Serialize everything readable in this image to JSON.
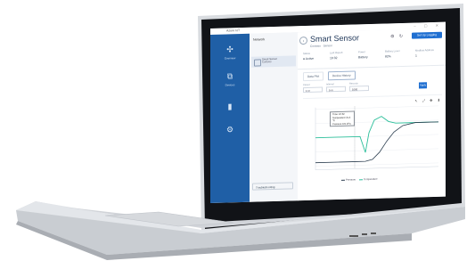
{
  "app": {
    "name": "Azure IoT",
    "window_controls": "– ▢ ✕"
  },
  "rail": {
    "items": [
      {
        "icon": "network-icon",
        "glyph": "✣",
        "label": "Overview"
      },
      {
        "icon": "folder-icon",
        "glyph": "🗀",
        "label": "Devices"
      },
      {
        "icon": "sensor-icon",
        "glyph": "⬮",
        "label": ""
      },
      {
        "icon": "settings-icon",
        "glyph": "⚙",
        "label": ""
      }
    ]
  },
  "devices": {
    "header": "Network",
    "items": [
      {
        "label": "Smart Sensor",
        "sub": "Contoso"
      }
    ],
    "troubleshoot_label": "Troubleshooting"
  },
  "main": {
    "title": "Smart Sensor",
    "subtitle": "Contoso · Sensor",
    "setup_button": "Set Up Logging",
    "stats": [
      {
        "key": "Status",
        "value": "● Active"
      },
      {
        "key": "Last Report",
        "value": "10:32"
      },
      {
        "key": "Power",
        "value": "Battery"
      },
      {
        "key": "Battery Level",
        "value": "82%"
      },
      {
        "key": "Modbus Address",
        "value": "1"
      }
    ],
    "tabs": [
      {
        "label": "Data Plot"
      },
      {
        "label": "Device History"
      }
    ],
    "controls": [
      {
        "key": "Period",
        "value": "1 hr"
      },
      {
        "key": "Interval",
        "value": "5 m"
      },
      {
        "key": "Records",
        "value": "1000"
      }
    ],
    "apply_label": "Apply",
    "tooltip": {
      "line1": "Time: 10:32",
      "line2": "Temperature 21.4 °C",
      "line3": "Pressure 101 kPa"
    },
    "legend": {
      "items": [
        {
          "label": "Pressure",
          "color": "#2c3e50"
        },
        {
          "label": "Temperature",
          "color": "#2bbf9a"
        }
      ]
    }
  },
  "colors": {
    "rail": "#1f5fa6",
    "accent": "#1f6fd1",
    "series_temp": "#2bbf9a",
    "series_pressure": "#2c3e50"
  }
}
